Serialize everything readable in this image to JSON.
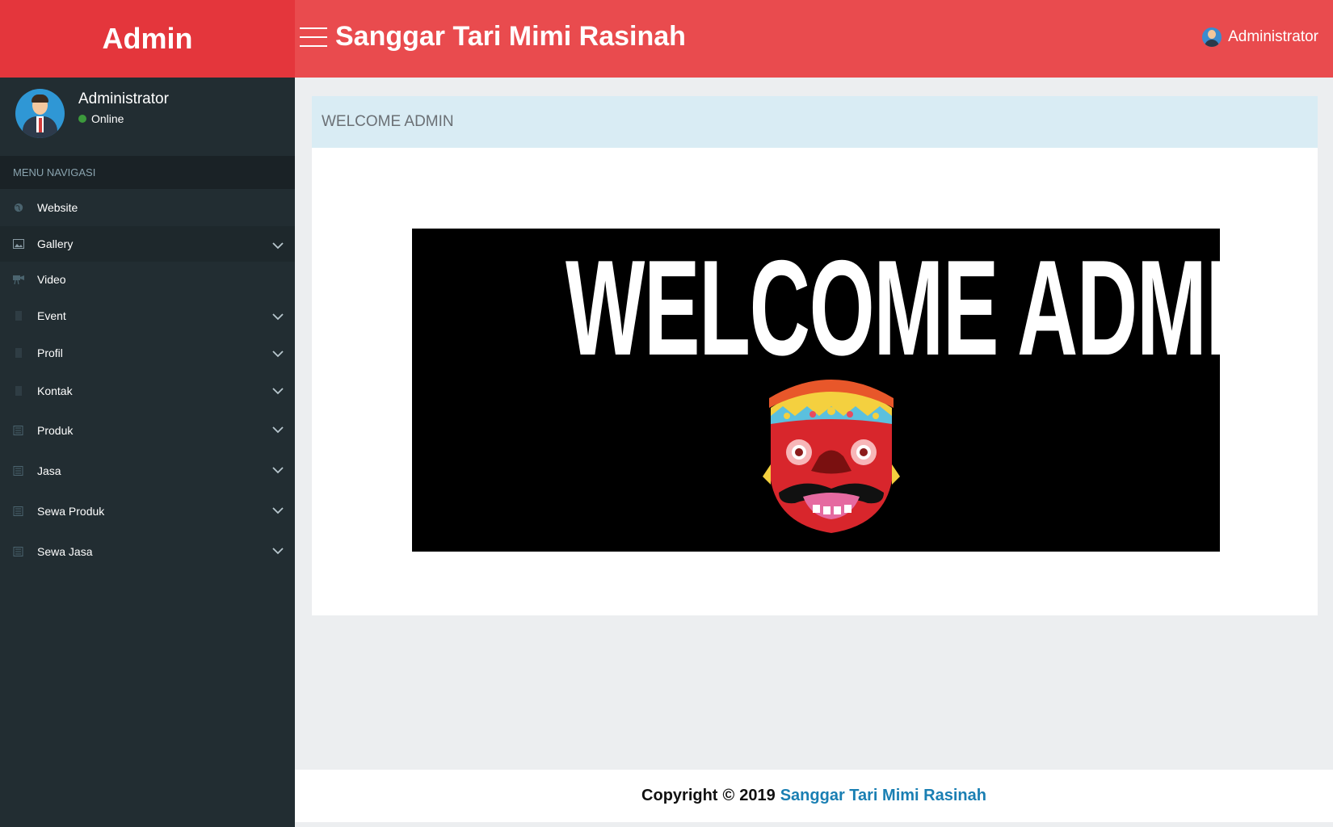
{
  "header": {
    "brand": "Admin",
    "site_title": "Sanggar Tari Mimi Rasinah",
    "user_label": "Administrator"
  },
  "sidebar": {
    "user": {
      "name": "Administrator",
      "status": "Online"
    },
    "menu_header": "MENU NAVIGASI",
    "items": [
      {
        "label": "Website",
        "icon": "globe-icon",
        "expandable": false
      },
      {
        "label": "Gallery",
        "icon": "image-icon",
        "expandable": true
      },
      {
        "label": "Video",
        "icon": "video-camera-icon",
        "expandable": false
      },
      {
        "label": "Event",
        "icon": "file-icon",
        "expandable": true
      },
      {
        "label": "Profil",
        "icon": "file-icon",
        "expandable": true
      },
      {
        "label": "Kontak",
        "icon": "file-icon",
        "expandable": true
      },
      {
        "label": "Produk",
        "icon": "list-icon",
        "expandable": true
      },
      {
        "label": "Jasa",
        "icon": "list-icon",
        "expandable": true
      },
      {
        "label": "Sewa Produk",
        "icon": "list-icon",
        "expandable": true
      },
      {
        "label": "Sewa Jasa",
        "icon": "list-icon",
        "expandable": true
      }
    ]
  },
  "content": {
    "box_title": "WELCOME ADMIN",
    "banner_text": "WELCOME ADMIN"
  },
  "footer": {
    "copyright": "Copyright",
    "symbol": "©",
    "year": "2019",
    "link_text": "Sanggar Tari Mimi Rasinah"
  },
  "colors": {
    "brand_red": "#e4363c",
    "topbar_red": "#e94b4e",
    "sidebar_bg": "#222d32",
    "link_blue": "#1a7fb3",
    "box_header_bg": "#d9ecf4"
  }
}
